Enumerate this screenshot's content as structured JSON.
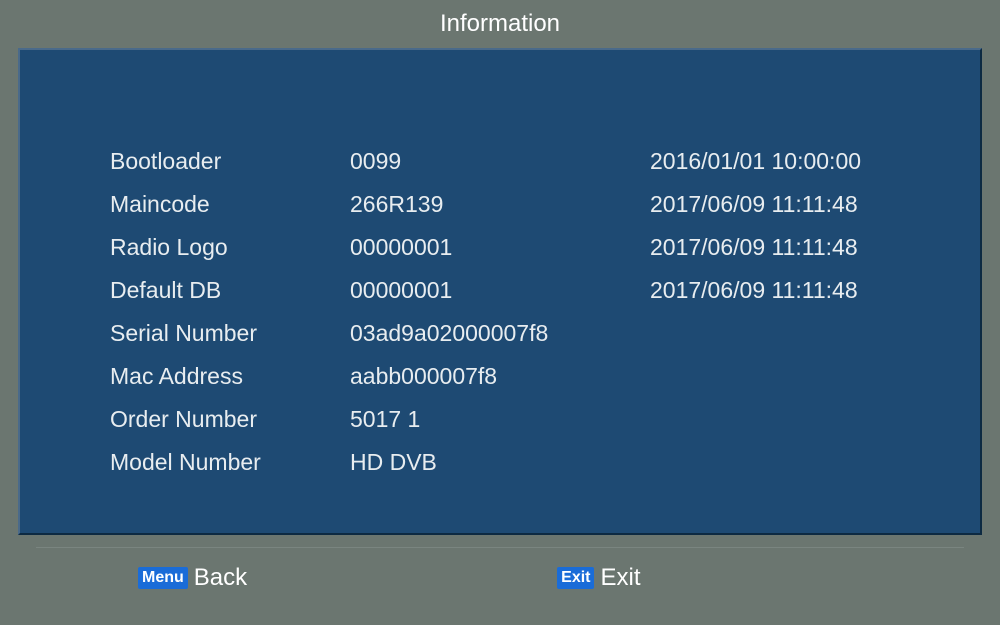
{
  "title": "Information",
  "rows": [
    {
      "label": "Bootloader",
      "value": "0099",
      "date": "2016/01/01 10:00:00"
    },
    {
      "label": "Maincode",
      "value": "266R139",
      "date": "2017/06/09 11:11:48"
    },
    {
      "label": "Radio Logo",
      "value": "00000001",
      "date": "2017/06/09 11:11:48"
    },
    {
      "label": "Default DB",
      "value": "00000001",
      "date": "2017/06/09 11:11:48"
    },
    {
      "label": "Serial Number",
      "value": "03ad9a02000007f8",
      "date": ""
    },
    {
      "label": "Mac Address",
      "value": "aabb000007f8",
      "date": ""
    },
    {
      "label": "Order Number",
      "value": "5017 1",
      "date": ""
    },
    {
      "label": "Model Number",
      "value": "HD DVB",
      "date": ""
    }
  ],
  "footer": {
    "back": {
      "badge": "Menu",
      "label": "Back"
    },
    "exit": {
      "badge": "Exit",
      "label": "Exit"
    }
  }
}
